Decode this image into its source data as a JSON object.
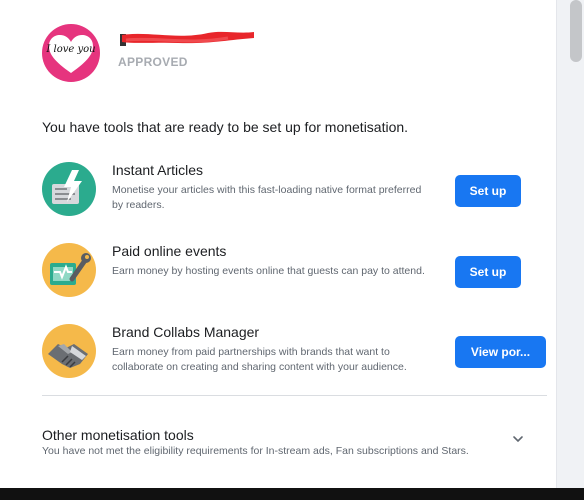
{
  "profile": {
    "avatar_text": "I love you",
    "status": "APPROVED"
  },
  "intro": "You have tools that are ready to be set up for monetisation.",
  "tools": [
    {
      "title": "Instant Articles",
      "description": "Monetise your articles with this fast-loading native format preferred by readers.",
      "button": "Set up",
      "icon": "instant-articles-icon"
    },
    {
      "title": "Paid online events",
      "description": "Earn money by hosting events online that guests can pay to attend.",
      "button": "Set up",
      "icon": "paid-events-icon"
    },
    {
      "title": "Brand Collabs Manager",
      "description": "Earn money from paid partnerships with brands that want to collaborate on creating and sharing content with your audience.",
      "button": "View por...",
      "icon": "handshake-icon"
    }
  ],
  "other": {
    "title": "Other monetisation tools",
    "description": "You have not met the eligibility requirements for In-stream ads, Fan subscriptions and Stars."
  },
  "colors": {
    "button": "#1877f2",
    "avatar": "#e6347e",
    "redaction": "#e8262b",
    "muted": "#a7abb1"
  }
}
